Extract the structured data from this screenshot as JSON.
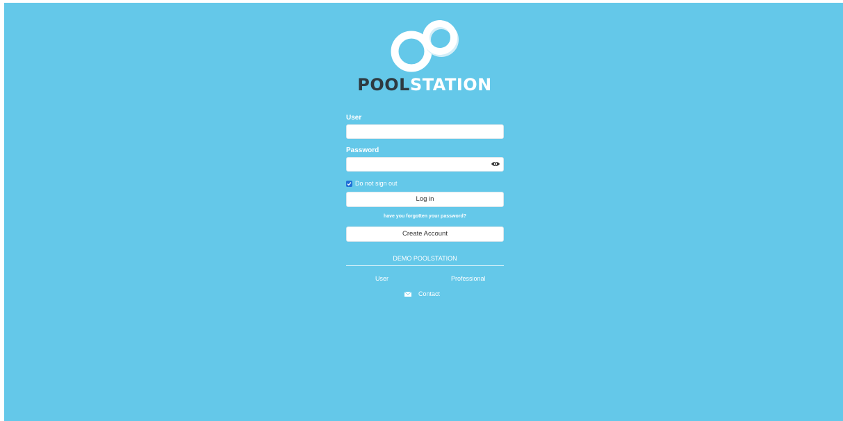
{
  "brand": {
    "name_dark": "POOL",
    "name_light": "STATION"
  },
  "login": {
    "user_label": "User",
    "user_value": "",
    "password_label": "Password",
    "password_value": "",
    "remember_label": "Do not sign out",
    "remember_checked": true,
    "login_button": "Log in",
    "forgot_link": "have you forgotten your password?",
    "create_account_button": "Create Account"
  },
  "demo": {
    "title": "DEMO POOLSTATION",
    "user_link": "User",
    "professional_link": "Professional"
  },
  "contact": {
    "label": "Contact",
    "icon": "envelope-icon"
  },
  "colors": {
    "background": "#64c8e9",
    "brand_dark": "#2e3a40",
    "checkbox": "#1f6fd6"
  }
}
